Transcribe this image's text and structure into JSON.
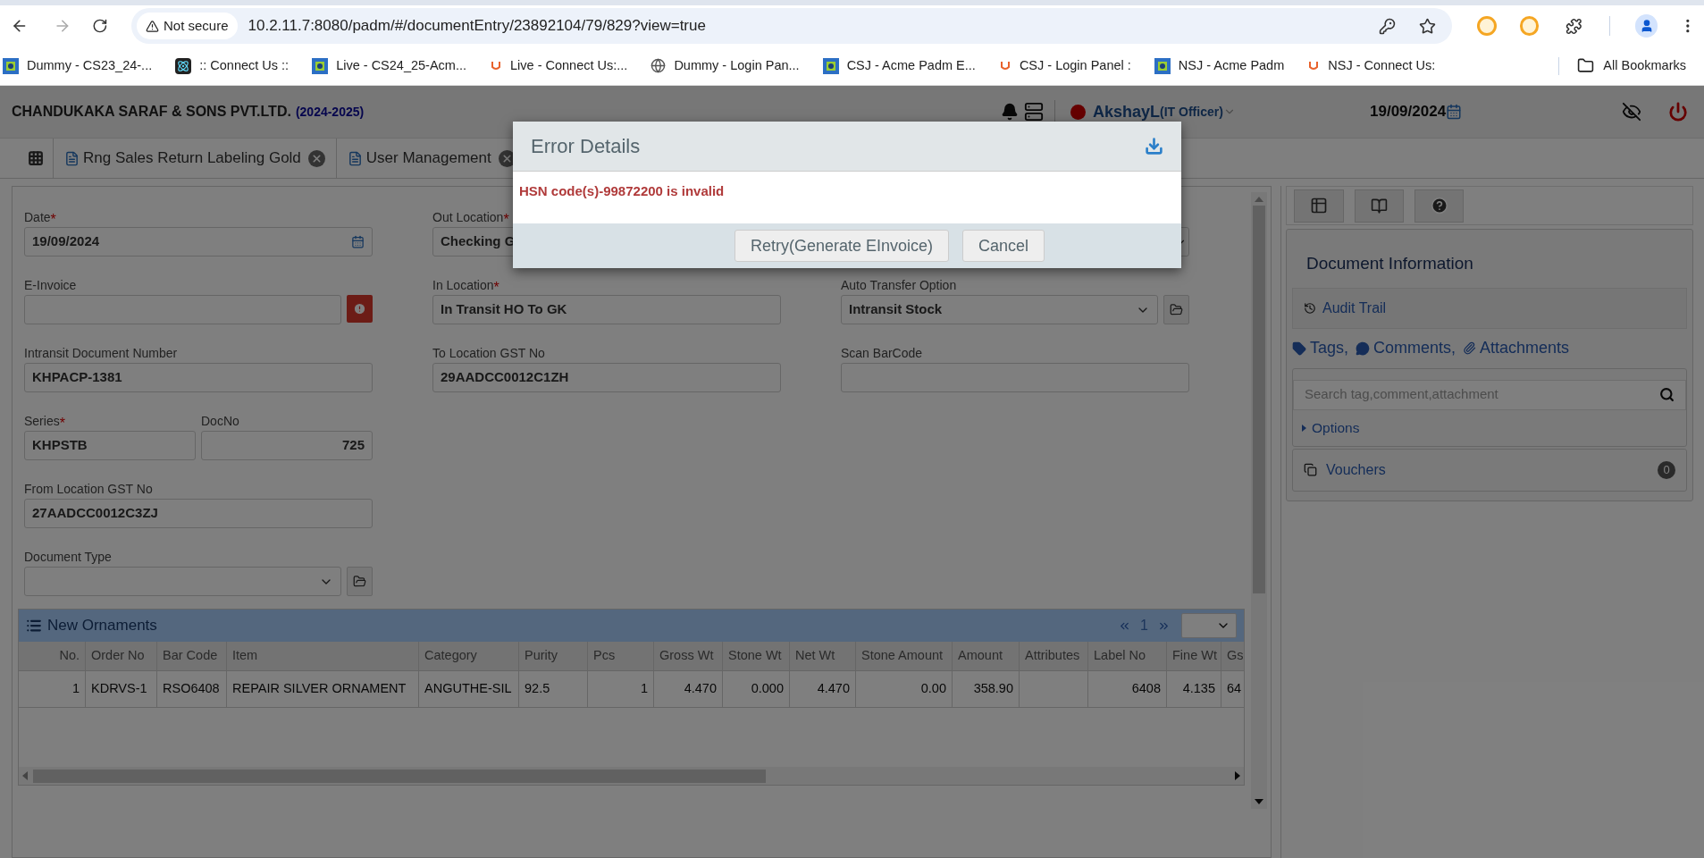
{
  "browser": {
    "security": "Not secure",
    "url": "10.2.11.7:8080/padm/#/documentEntry/23892104/79/829?view=true",
    "bookmarks": [
      {
        "kind": "puzzle",
        "label": "Dummy  - CS23_24-..."
      },
      {
        "kind": "atom",
        "label": ":: Connect Us ::"
      },
      {
        "kind": "puzzle",
        "label": "Live - CS24_25-Acm..."
      },
      {
        "kind": "logo",
        "label": "Live - Connect Us:..."
      },
      {
        "kind": "globe",
        "label": "Dummy - Login Pan..."
      },
      {
        "kind": "puzzle",
        "label": "CSJ - Acme Padm E..."
      },
      {
        "kind": "logo",
        "label": "CSJ - Login Panel :"
      },
      {
        "kind": "puzzle",
        "label": "NSJ - Acme Padm"
      },
      {
        "kind": "logo",
        "label": "NSJ - Connect Us:"
      }
    ],
    "all_bookmarks": "All Bookmarks"
  },
  "header": {
    "company": "CHANDUKAKA SARAF & SONS PVT.LTD.",
    "year": "(2024-2025)",
    "user": "AkshayL",
    "role": "(IT Officer)",
    "date": "19/09/2024"
  },
  "tabs": [
    {
      "label": "Rng Sales Return Labeling Gold"
    },
    {
      "label": "User Management"
    }
  ],
  "form": {
    "columns": [
      [
        {
          "kind": "date",
          "label": "Date",
          "mark": "*",
          "value": "19/09/2024"
        },
        {
          "kind": "input_alert",
          "label": "E-Invoice"
        },
        {
          "kind": "input",
          "label": "Intransit Document Number",
          "value": "KHPACP-1381"
        },
        {
          "kind": "pair",
          "fields": [
            {
              "label": "Series",
              "mark": "*",
              "value": "KHPSTB"
            },
            {
              "label": "DocNo",
              "value": "725"
            }
          ]
        },
        {
          "kind": "input",
          "label": "From Location GST No",
          "value": "27AADCC0012C3ZJ"
        },
        {
          "kind": "select_action",
          "label": "Document Type"
        }
      ],
      [
        {
          "kind": "input",
          "label": "Out Location",
          "mark": "*",
          "value": "Checking G"
        },
        {
          "kind": "input",
          "label": "In Location",
          "mark": "*",
          "value": "In Transit HO To GK"
        },
        {
          "kind": "input",
          "label": "To Location GST No",
          "value": "29AADCC0012C1ZH"
        }
      ],
      [
        {
          "kind": "select"
        },
        {
          "kind": "select_action",
          "label": "Auto Transfer Option",
          "value": "Intransit Stock"
        },
        {
          "kind": "input",
          "label": "Scan BarCode"
        }
      ]
    ]
  },
  "table": {
    "title": "New Ornaments",
    "page": "1",
    "columns": [
      "No.",
      "Order No",
      "Bar Code",
      "Item",
      "Category",
      "Purity",
      "Pcs",
      "Gross Wt",
      "Stone Wt",
      "Net Wt",
      "Stone Amount",
      "Amount",
      "Attributes",
      "Label No",
      "Fine Wt",
      "Gs"
    ],
    "rows": [
      {
        "cells": [
          "1",
          "KDRVS-1",
          "RSO6408",
          "REPAIR SILVER ORNAMENT",
          "ANGUTHE-SIL",
          "92.5",
          "1",
          "4.470",
          "0.000",
          "4.470",
          "0.00",
          "358.90",
          "",
          "6408",
          "4.135",
          "64"
        ]
      }
    ]
  },
  "doc_info": {
    "title": "Document Information",
    "audit_trail": "Audit Trail",
    "tags": "Tags,",
    "comments": "Comments,",
    "attachments": "Attachments",
    "search_placeholder": "Search tag,comment,attachment",
    "options": "Options",
    "vouchers": "Vouchers",
    "vouchers_count": "0"
  },
  "modal": {
    "title": "Error Details",
    "message": "HSN code(s)-99872200 is invalid",
    "buttons": [
      "Retry(Generate EInvoice)",
      "Cancel"
    ]
  }
}
